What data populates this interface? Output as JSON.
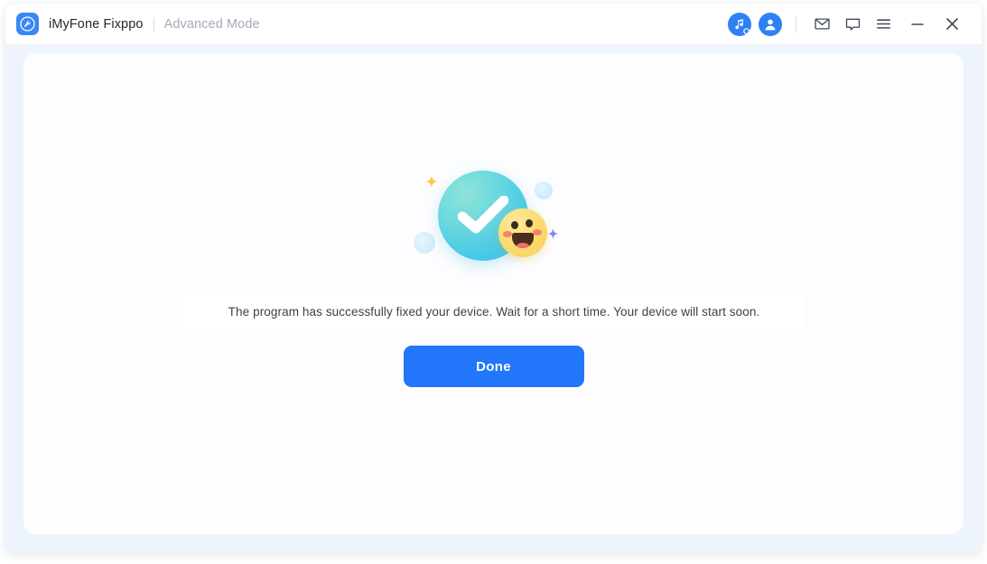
{
  "window": {
    "titlebar": {
      "app_icon": "wrench-app-icon",
      "app_name": "iMyFone Fixppo",
      "separator": "|",
      "mode_label": "Advanced Mode",
      "actions": [
        {
          "name": "music-search-icon",
          "label": ""
        },
        {
          "name": "user-account-icon",
          "label": ""
        },
        {
          "name": "mail-icon",
          "label": ""
        },
        {
          "name": "feedback-icon",
          "label": ""
        },
        {
          "name": "menu-icon",
          "label": ""
        },
        {
          "name": "minimize-icon",
          "label": ""
        },
        {
          "name": "close-icon",
          "label": ""
        }
      ]
    },
    "content": {
      "illustration": {
        "name": "success-check-illustration",
        "check_circle_color": "#49c8e8",
        "emoji_color": "#f7cf5b",
        "sparkle_yellow": "#fcc council",
        "sparkle_blue": "#7f8cf0"
      },
      "message": "The program has successfully fixed your device. Wait for a short time. Your device will start soon.",
      "primary_button": "Done"
    }
  },
  "colors": {
    "accent_blue": "#2176f9",
    "window_bg": "#eef4fc",
    "card_bg": "#fdfdff",
    "title_text": "#24292e",
    "subtitle_text": "#a2abb7",
    "message_text": "#3c4149"
  }
}
